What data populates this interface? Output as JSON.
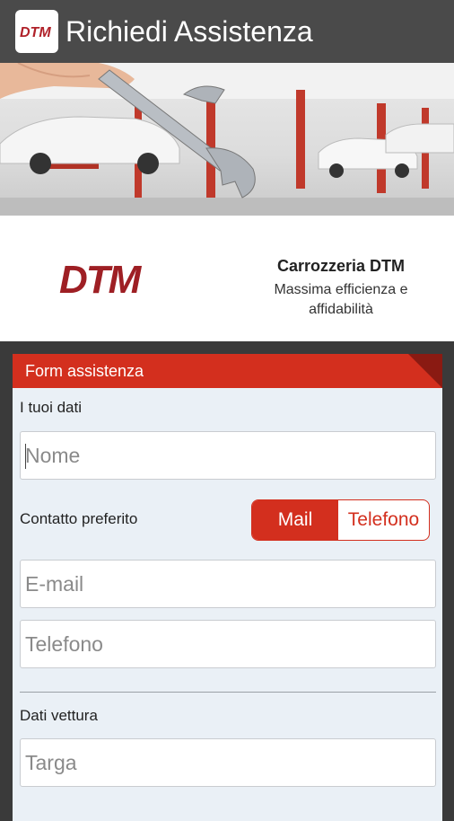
{
  "appbar": {
    "title": "Richiedi Assistenza",
    "logo_text": "DTM"
  },
  "brand": {
    "logo_text": "DTM",
    "name": "Carrozzeria DTM",
    "tagline": "Massima efficienza e affidabilità"
  },
  "form": {
    "header": "Form assistenza",
    "personal_section": "I tuoi dati",
    "name_placeholder": "Nome",
    "contact_label": "Contatto preferito",
    "contact_options": [
      "Mail",
      "Telefono"
    ],
    "contact_selected": "Mail",
    "email_placeholder": "E-mail",
    "phone_placeholder": "Telefono",
    "vehicle_section": "Dati vettura",
    "plate_placeholder": "Targa"
  },
  "colors": {
    "accent": "#d32f1e",
    "appbar": "#4a4a4a",
    "card": "#eaf0f6"
  },
  "icons": {
    "app_logo": "dtm-logo-icon",
    "hero": "garage-wrench-photo"
  }
}
